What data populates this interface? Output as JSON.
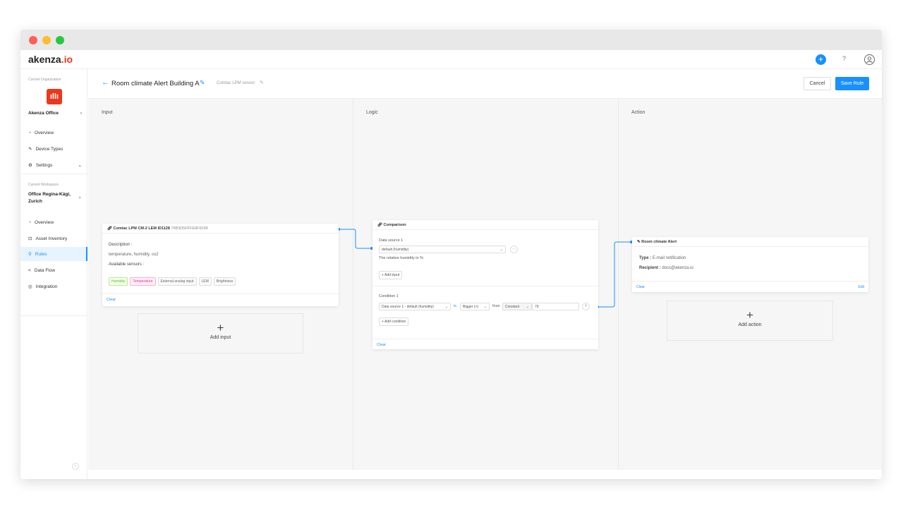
{
  "app": {
    "logo": "akenza.io"
  },
  "topbar": {
    "help": "?"
  },
  "sidebar": {
    "org_label": "Current Organization",
    "org_name": "Akenza Office",
    "org_items": [
      {
        "label": "Overview"
      },
      {
        "label": "Device Types"
      },
      {
        "label": "Settings"
      }
    ],
    "ws_label": "Current Workspace",
    "ws_name_1": "Office Regina-Kägi,",
    "ws_name_2": "Zurich",
    "ws_items": [
      {
        "label": "Overview"
      },
      {
        "label": "Asset Inventory"
      },
      {
        "label": "Rules"
      },
      {
        "label": "Data Flow"
      },
      {
        "label": "Integration"
      }
    ]
  },
  "header": {
    "title": "Room climate Alert Building A",
    "subtitle": "Comtac LPM sensor",
    "cancel": "Cancel",
    "save": "Save Rule"
  },
  "columns": {
    "input": "Input",
    "logic": "Logic",
    "action": "Action"
  },
  "input_card": {
    "title": "Comtac LPM CM-2 LEM ID1128",
    "device_id": "70B3D5FFFE8F6299",
    "desc_label": "Description :",
    "desc": "temperature, humidity, co2",
    "sensors_label": "Available sensors :",
    "sensors": [
      "Humidity",
      "Temperature",
      "External analog input",
      "LEM",
      "Brightness"
    ],
    "clear": "Clear"
  },
  "add_input": {
    "plus": "+",
    "label": "Add input"
  },
  "logic_card": {
    "title": "Comparison",
    "ds_label": "Data source 1",
    "ds_value": "default (humidity)",
    "more": "···",
    "ds_desc": "The relative humidity in %",
    "add_input": "+ Add input",
    "cond_label": "Condition 1",
    "cond_source": "Data source 1 - default (humidity)",
    "is": "is",
    "op": "Bigger (>)",
    "than": "than",
    "type": "Constant",
    "value": "79",
    "plus": "+",
    "add_condition": "+ Add condition",
    "clear": "Clear"
  },
  "action_card": {
    "title": "Room climate Alert",
    "type_label": "Type :",
    "type": "E-mail notification",
    "recipient_label": "Recipient :",
    "recipient": "docs@akenza.io",
    "clear": "Clear",
    "edit": "Edit"
  },
  "add_action": {
    "plus": "+",
    "label": "Add action"
  },
  "colors": {
    "accent": "#1890ff",
    "brand": "#e8391c"
  }
}
